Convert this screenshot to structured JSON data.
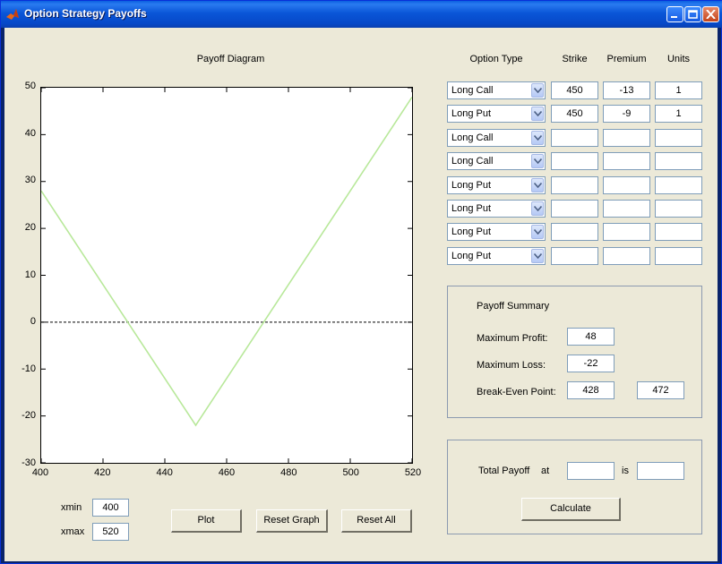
{
  "window": {
    "title": "Option Strategy Payoffs"
  },
  "plot": {
    "title": "Payoff Diagram",
    "yticks": [
      "50",
      "40",
      "30",
      "20",
      "10",
      "0",
      "-10",
      "-20",
      "-30"
    ],
    "xticks": [
      "400",
      "420",
      "440",
      "460",
      "480",
      "500",
      "520"
    ]
  },
  "chart_data": {
    "type": "line",
    "title": "Payoff Diagram",
    "xlim": [
      400,
      520
    ],
    "ylim": [
      -30,
      50
    ],
    "series": [
      {
        "x": [
          400,
          450,
          520
        ],
        "y": [
          28,
          -22,
          48
        ],
        "color": "#b8e89a"
      }
    ],
    "zero_line": {
      "y": 0,
      "style": "dashed"
    },
    "grid": false
  },
  "table": {
    "headers": {
      "type": "Option Type",
      "strike": "Strike",
      "premium": "Premium",
      "units": "Units"
    },
    "rows": [
      {
        "type": "Long Call",
        "strike": "450",
        "premium": "-13",
        "units": "1"
      },
      {
        "type": "Long Put",
        "strike": "450",
        "premium": "-9",
        "units": "1"
      },
      {
        "type": "Long Call",
        "strike": "",
        "premium": "",
        "units": ""
      },
      {
        "type": "Long Call",
        "strike": "",
        "premium": "",
        "units": ""
      },
      {
        "type": "Long Put",
        "strike": "",
        "premium": "",
        "units": ""
      },
      {
        "type": "Long Put",
        "strike": "",
        "premium": "",
        "units": ""
      },
      {
        "type": "Long Put",
        "strike": "",
        "premium": "",
        "units": ""
      },
      {
        "type": "Long Put",
        "strike": "",
        "premium": "",
        "units": ""
      }
    ]
  },
  "summary": {
    "title": "Payoff Summary",
    "max_profit_label": "Maximum Profit:",
    "max_profit": "48",
    "max_loss_label": "Maximum Loss:",
    "max_loss": "-22",
    "breakeven_label": "Break-Even Point:",
    "breakeven_low": "428",
    "breakeven_high": "472"
  },
  "total": {
    "label": "Total Payoff",
    "at_label": "at",
    "at_value": "",
    "is_label": "is",
    "is_value": "",
    "calculate_label": "Calculate"
  },
  "range": {
    "xmin_label": "xmin",
    "xmin": "400",
    "xmax_label": "xmax",
    "xmax": "520"
  },
  "buttons": {
    "plot": "Plot",
    "reset_graph": "Reset Graph",
    "reset_all": "Reset All"
  },
  "colors": {
    "titlebar": "#0a56d8",
    "payoff_line": "#b8e89a",
    "background": "#ece9d8"
  }
}
